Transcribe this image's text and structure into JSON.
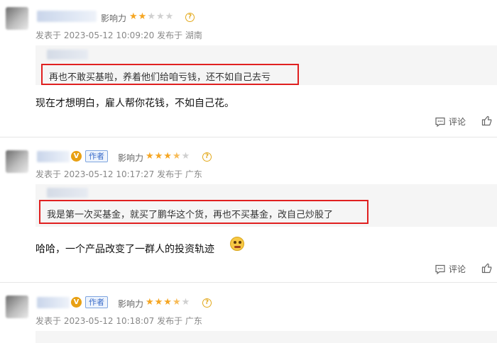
{
  "icons": {
    "help": "?",
    "verified": "V",
    "comment": "comment-icon",
    "like": "thumbs-up-icon"
  },
  "colors": {
    "highlight_border": "#e02020",
    "star": "#f5a623",
    "author_tag": "#3a6cc9",
    "quote_bg": "#f5f5f5"
  },
  "comments": [
    {
      "influence_label": "影响力",
      "rating": 2,
      "rating_max": 5,
      "meta": "发表于 2023-05-12 10:09:20 发布于 湖南",
      "quote": "再也不敢买基啦，养着他们给咱亏钱，还不如自己去亏",
      "body": "现在才想明白，雇人帮你花钱，不如自己花。",
      "reply_label": "评论"
    },
    {
      "author_tag": "作者",
      "influence_label": "影响力",
      "rating": 3.5,
      "rating_max": 5,
      "meta": "发表于 2023-05-12 10:17:27 发布于 广东",
      "quote": "我是第一次买基金，就买了鹏华这个货，再也不买基金，改自己炒股了",
      "body": "哈哈，一个产品改变了一群人的投资轨迹",
      "reply_label": "评论"
    },
    {
      "author_tag": "作者",
      "influence_label": "影响力",
      "rating": 3.5,
      "rating_max": 5,
      "meta": "发表于 2023-05-12 10:18:07 发布于 广东"
    }
  ]
}
